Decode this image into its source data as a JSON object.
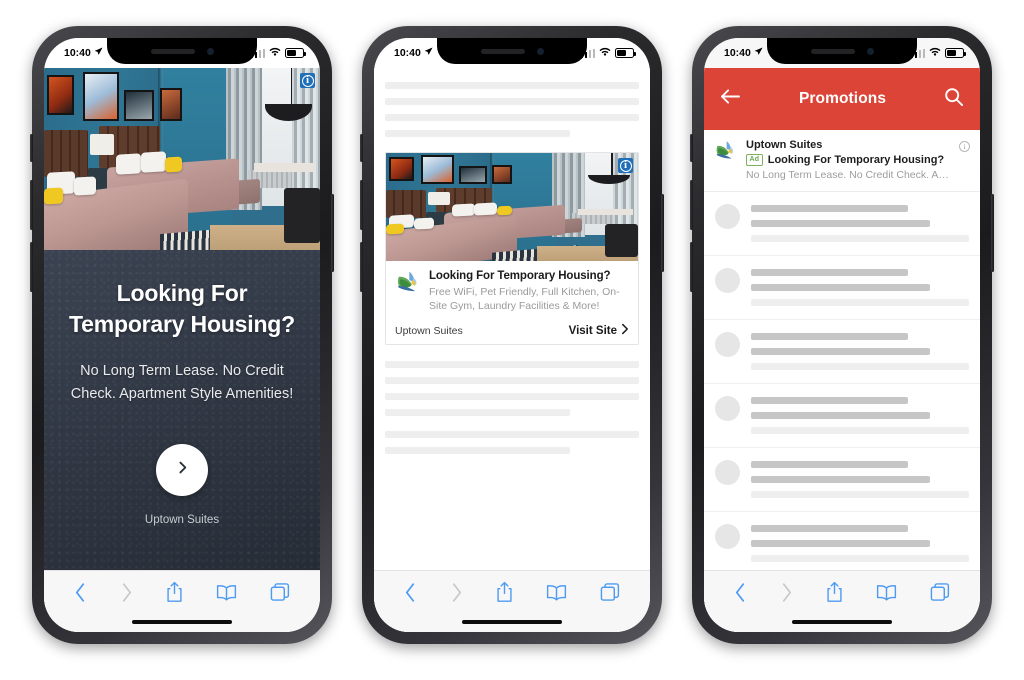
{
  "meta": {
    "brand_red": "#db4437",
    "interstitial_bg": "#343c4b",
    "safari_blue": "#0f7cf5",
    "ad_badge_green": "#6aa84f"
  },
  "status_bar": {
    "time": "10:40",
    "location_icon": "location-arrow-icon",
    "signal_icon": "cellular-bars-icon",
    "wifi_icon": "wifi-icon",
    "battery_icon": "battery-icon"
  },
  "safari_toolbar": {
    "back_label": "back-icon",
    "forward_label": "forward-icon",
    "share_label": "share-icon",
    "bookmarks_label": "bookmarks-icon",
    "tabs_label": "tabs-icon"
  },
  "ad": {
    "adchoices_icon": "adchoices-info-icon",
    "adchoices_letter": "i",
    "logo_icon": "uptown-suites-bird-logo-icon",
    "headline": "Looking For Temporary Housing?",
    "headline_line1": "Looking For",
    "headline_line2": "Temporary Housing?",
    "subhead": "No Long Term Lease. No Credit Check. Apartment Style Amenities!",
    "brand": "Uptown Suites",
    "cta_arrow_icon": "chevron-right-icon",
    "feed_description": "Free WiFi, Pet Friendly, Full Kitchen, On-Site Gym, Laundry Facilities & More!",
    "visit_label": "Visit Site",
    "visit_chevron_icon": "chevron-right-icon"
  },
  "phone1": {
    "name": "interstitial-ad-screen",
    "photo_alt": "hotel-room-two-beds-photo"
  },
  "phone2": {
    "name": "in-feed-ad-screen",
    "photo_alt": "hotel-room-two-beds-photo",
    "skeleton_top": [
      {
        "w": "100%"
      },
      {
        "w": "100%"
      },
      {
        "w": "100%"
      },
      {
        "w": "73%"
      }
    ],
    "skeleton_bottom": [
      {
        "w": "100%"
      },
      {
        "w": "100%"
      },
      {
        "w": "100%"
      },
      {
        "w": "73%"
      }
    ],
    "skeleton_bottom2": [
      {
        "w": "100%"
      },
      {
        "w": "73%"
      }
    ]
  },
  "phone3": {
    "name": "promotions-inbox-screen",
    "header": {
      "back_icon": "arrow-left-icon",
      "title": "Promotions",
      "search_icon": "search-icon"
    },
    "promo_ad": {
      "sender": "Uptown Suites",
      "ad_badge": "Ad",
      "subject": "Looking For Temporary Housing?",
      "snippet": "No Long Term Lease. No Credit Check. A…",
      "info_icon": "info-circle-icon",
      "info_letter": "i"
    },
    "rows": [
      {
        "l1": "72%",
        "l2": "82%",
        "l3": "100%"
      },
      {
        "l1": "72%",
        "l2": "82%",
        "l3": "100%"
      },
      {
        "l1": "72%",
        "l2": "82%",
        "l3": "100%"
      },
      {
        "l1": "72%",
        "l2": "82%",
        "l3": "100%"
      },
      {
        "l1": "72%",
        "l2": "82%",
        "l3": "100%"
      },
      {
        "l1": "72%",
        "l2": "82%",
        "l3": "100%"
      },
      {
        "l1": "72%",
        "l2": "82%",
        "l3": "100%"
      }
    ]
  }
}
